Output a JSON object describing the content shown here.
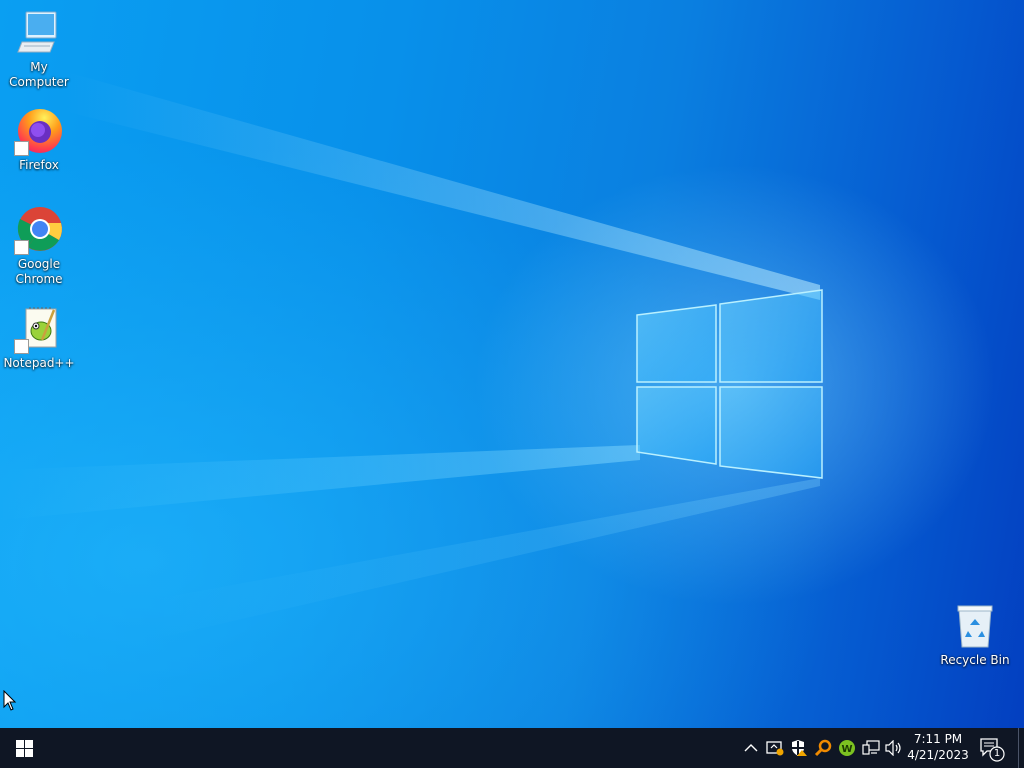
{
  "desktop": {
    "icons": [
      {
        "label": "My Computer",
        "icon": "computer-icon"
      },
      {
        "label": "Firefox",
        "icon": "firefox-icon"
      },
      {
        "label": "Google Chrome",
        "icon": "chrome-icon"
      },
      {
        "label": "Notepad++",
        "icon": "notepadpp-icon"
      },
      {
        "label": "Recycle Bin",
        "icon": "recycle-bin-icon"
      }
    ]
  },
  "taskbar": {
    "start_icon": "windows-logo-icon",
    "tray_icons": [
      "chevron-up-icon",
      "security-status-icon",
      "defender-shield-icon",
      "search-tool-icon",
      "green-app-icon",
      "network-icon",
      "volume-icon"
    ],
    "clock": {
      "time": "7:11 PM",
      "date": "4/21/2023"
    },
    "notification_count": "1"
  },
  "colors": {
    "taskbar": "#0f1624",
    "wallpaper_accent": "#0a9ff2"
  }
}
